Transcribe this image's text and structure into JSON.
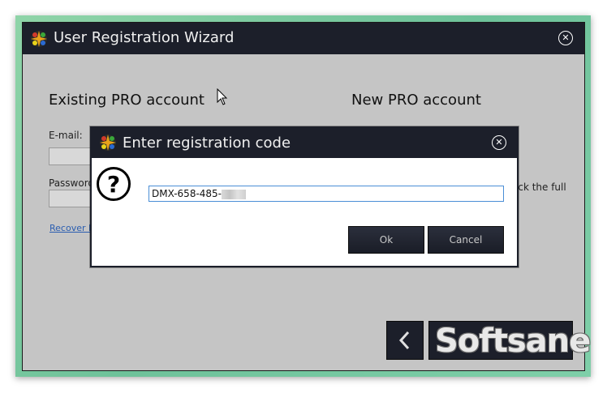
{
  "window": {
    "title": "User Registration Wizard",
    "close_glyph": "✕"
  },
  "existing": {
    "heading": "Existing PRO account",
    "email_label": "E-mail:",
    "password_label": "Password",
    "recover_link": "Recover lo"
  },
  "new_account": {
    "heading": "New PRO account",
    "partial_text": "ock the full"
  },
  "navigation": {
    "back_glyph": "‹"
  },
  "watermark": "Softsane",
  "dialog": {
    "title": "Enter registration code",
    "close_glyph": "✕",
    "question_glyph": "?",
    "code_value": "DMX-658-485-",
    "ok_label": "Ok",
    "cancel_label": "Cancel"
  },
  "colors": {
    "titlebar": "#1c1f2a",
    "window_bg": "#c5c5c5",
    "link": "#2a5db0",
    "input_focus_border": "#4a8ed6"
  }
}
